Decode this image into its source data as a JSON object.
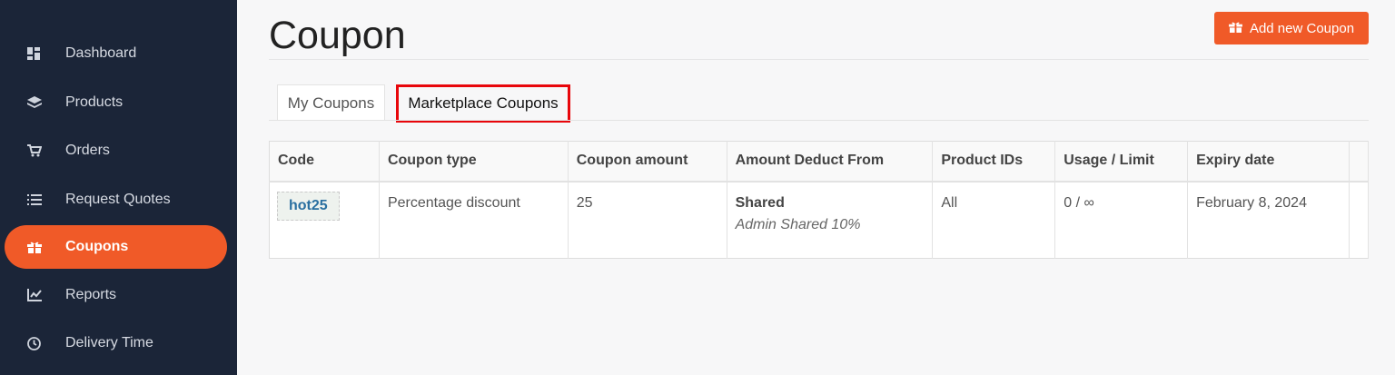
{
  "sidebar": {
    "items": [
      {
        "label": "Dashboard",
        "icon": "dashboard-icon"
      },
      {
        "label": "Products",
        "icon": "products-icon"
      },
      {
        "label": "Orders",
        "icon": "cart-icon"
      },
      {
        "label": "Request Quotes",
        "icon": "list-icon"
      },
      {
        "label": "Coupons",
        "icon": "gift-icon",
        "active": true
      },
      {
        "label": "Reports",
        "icon": "chart-icon"
      },
      {
        "label": "Delivery Time",
        "icon": "clock-icon"
      }
    ]
  },
  "header": {
    "title": "Coupon",
    "add_button_label": "Add new Coupon"
  },
  "tabs": [
    {
      "label": "My Coupons"
    },
    {
      "label": "Marketplace Coupons",
      "active": true
    }
  ],
  "table": {
    "headers": [
      "Code",
      "Coupon type",
      "Coupon amount",
      "Amount Deduct From",
      "Product IDs",
      "Usage / Limit",
      "Expiry date"
    ],
    "rows": [
      {
        "code": "hot25",
        "type": "Percentage discount",
        "amount": "25",
        "deduct_main": "Shared",
        "deduct_sub": "Admin Shared 10%",
        "product_ids": "All",
        "usage": "0 / ∞",
        "expiry": "February 8, 2024"
      }
    ]
  },
  "colors": {
    "accent": "#f05a28",
    "sidebar_bg": "#1b2538",
    "highlight_box": "#e8060b"
  }
}
